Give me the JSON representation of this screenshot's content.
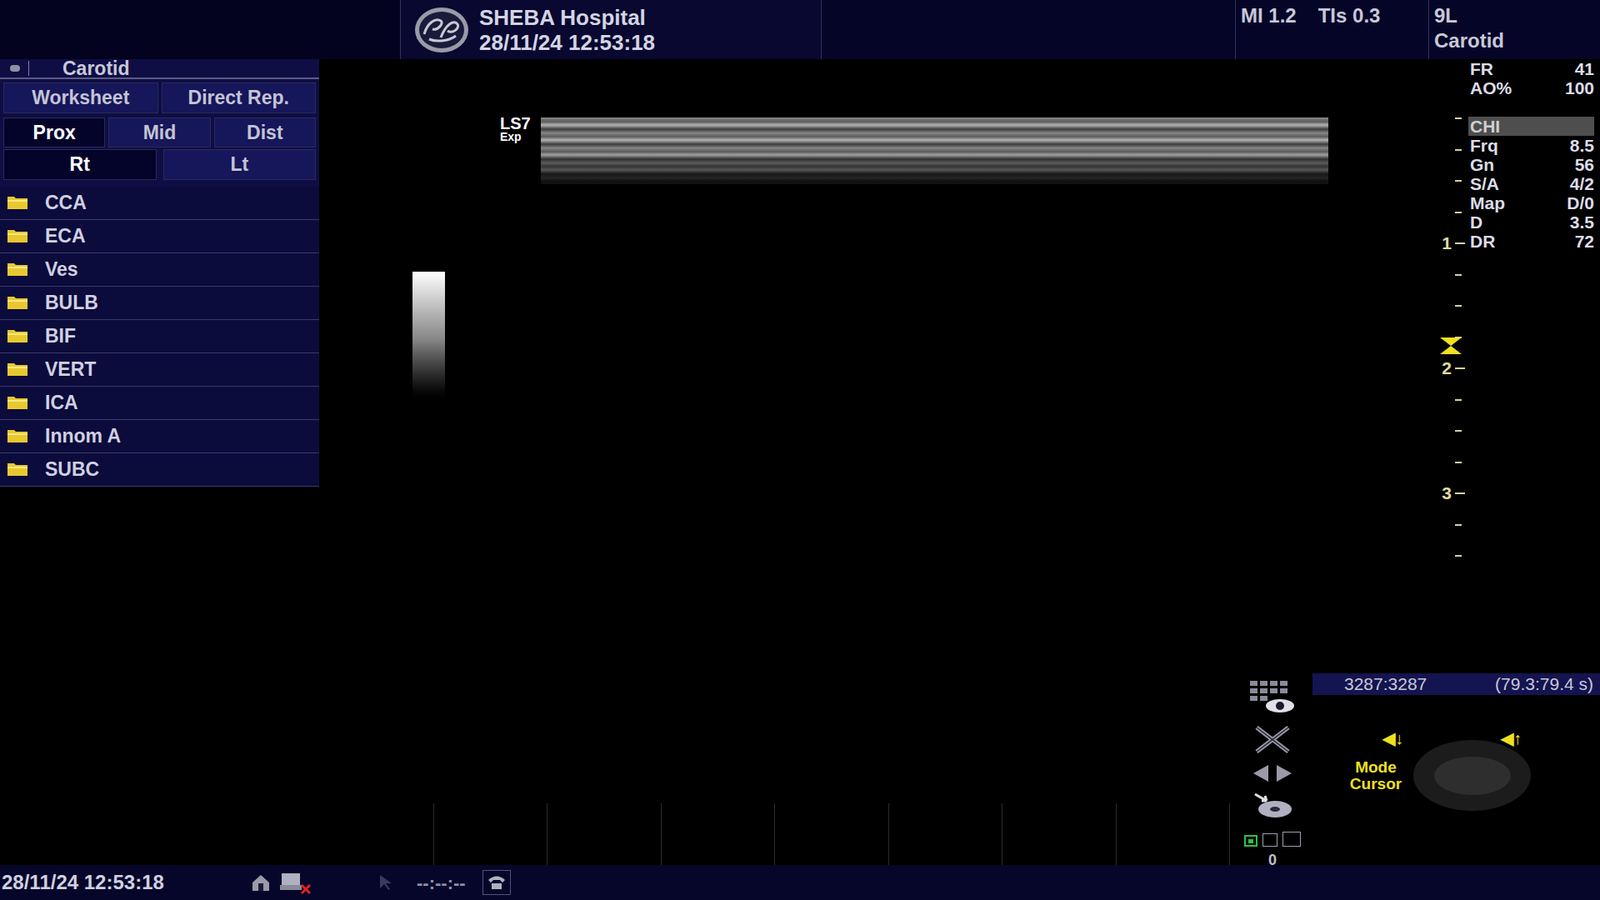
{
  "header": {
    "hospital": "SHEBA Hospital",
    "datetime": "28/11/24 12:53:18",
    "mi": "MI 1.2",
    "tis": "TIs 0.3",
    "probe": "9L",
    "preset": "Carotid"
  },
  "sidebar": {
    "title": "Carotid",
    "tabs": [
      {
        "label": "Worksheet",
        "selected": false
      },
      {
        "label": "Direct Rep.",
        "selected": false
      }
    ],
    "segments": [
      {
        "label": "Prox",
        "selected": true
      },
      {
        "label": "Mid",
        "selected": false
      },
      {
        "label": "Dist",
        "selected": false
      }
    ],
    "sides": [
      {
        "label": "Rt",
        "selected": true
      },
      {
        "label": "Lt",
        "selected": false
      }
    ],
    "folders": [
      "CCA",
      "ECA",
      "Ves",
      "BULB",
      "BIF",
      "VERT",
      "ICA",
      "Innom A",
      "SUBC"
    ]
  },
  "image": {
    "probe_label": "LS7",
    "mode_label": "Exp"
  },
  "depth_scale": {
    "labels": [
      "1",
      "2",
      "3"
    ]
  },
  "display_params": [
    {
      "name": "FR",
      "value": "41",
      "selected": false
    },
    {
      "name": "AO%",
      "value": "100",
      "selected": false
    }
  ],
  "imaging_params": [
    {
      "name": "CHI",
      "selected": true
    },
    {
      "name": "Frq",
      "value": "8.5",
      "selected": false
    },
    {
      "name": "Gn",
      "value": "56",
      "selected": false
    },
    {
      "name": "S/A",
      "value": "4/2",
      "selected": false
    },
    {
      "name": "Map",
      "value": "D/0",
      "selected": false
    },
    {
      "name": "D",
      "value": "3.5",
      "selected": false
    },
    {
      "name": "DR",
      "value": "72",
      "selected": false
    }
  ],
  "cine": {
    "frames": "3287:3287",
    "time": "(79.3:79.4 s)"
  },
  "trackball": {
    "left_arrow": "◀↓",
    "right_arrow": "◀↑",
    "lines": [
      "Mode",
      "Cursor"
    ]
  },
  "page_counter": "0",
  "footer": {
    "datetime": "28/11/24 12:53:18",
    "timer": "--:--:--"
  }
}
